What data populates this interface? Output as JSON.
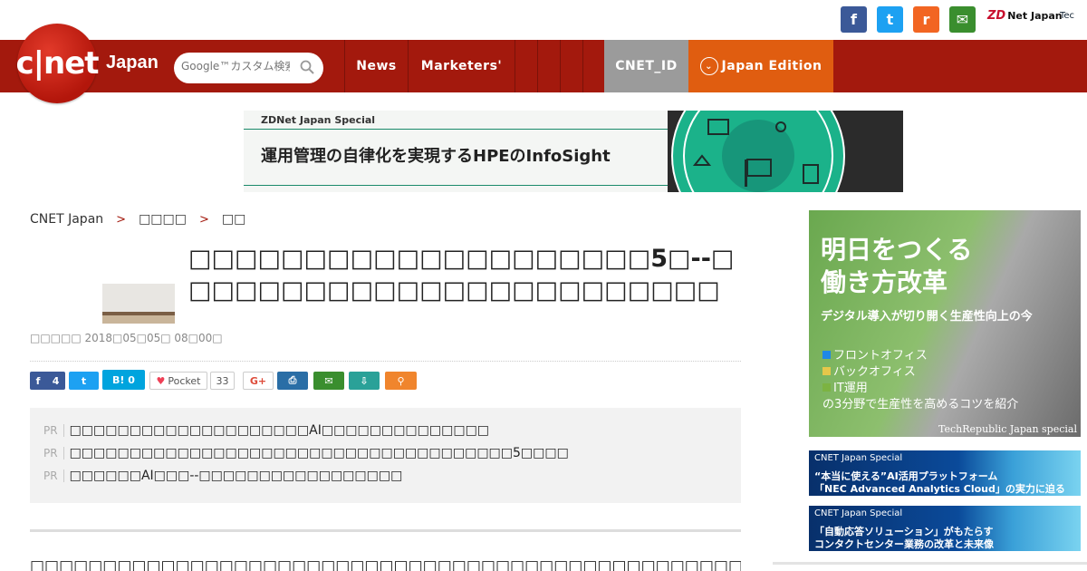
{
  "header": {
    "social": {
      "facebook": "f",
      "twitter": "t",
      "rss": "r",
      "mail": "✉"
    },
    "zdnet": {
      "logo": "ZD",
      "text": "Net Japan"
    },
    "tech_label": "Tec",
    "logo_text": "c|net",
    "logo_region": "Japan",
    "search_placeholder": "Google™カスタム検索",
    "nav": [
      "News",
      "Marketers'",
      "",
      "",
      "",
      ""
    ],
    "cnet_id": "CNET_ID",
    "edition": "Japan Edition"
  },
  "banner": {
    "tag": "ZDNet Japan Special",
    "title": "運用管理の自律化を実現するHPEのInfoSight"
  },
  "breadcrumb": [
    "CNET Japan",
    "□□□□",
    "□□"
  ],
  "article": {
    "title": "□□□□□□□□□□□□□□□□□□□□5□--□□□□□□□□□□□□□□□□□□□□□□□□",
    "byline": "□□□□□ 2018□05□05□ 08□00□"
  },
  "share": {
    "fb_count": "4",
    "hatena": "B! 0",
    "pocket": "Pocket",
    "pocket_count": "33",
    "gplus": "G+"
  },
  "pr": [
    {
      "tag": "PR",
      "text": "□□□□□□□□□□□□□□□□□□□□AI□□□□□□□□□□□□□□"
    },
    {
      "tag": "PR",
      "text": "□□□□□□□□□□□□□□□□□□□□□□□□□□□□□□□□□□□□□5□□□□"
    },
    {
      "tag": "PR",
      "text": "□□□□□□AI□□□--□□□□□□□□□□□□□□□□□"
    }
  ],
  "body_text": "□□□□□□□□□□□□□□□□□□□□□□□□□□□□□□□□□□□□□□□□□□□□□□□□□□□",
  "sidebar": {
    "ad_big": {
      "heading_1": "明日をつくる",
      "heading_2": "働き方改革",
      "sub": "デジタル導入が切り開く生産性向上の今",
      "items": [
        "フロントオフィス",
        "バックオフィス",
        "IT運用"
      ],
      "item_colors": [
        "#1e88e5",
        "#e6c74a",
        "#7cb342"
      ],
      "tagline": "の3分野で生産性を高めるコツを紹介",
      "footer": "TechRepublic Japan special"
    },
    "ad_small_1": {
      "tag": "CNET Japan Special",
      "line1": "“本当に使える”AI活用プラットフォーム",
      "line2": "「NEC Advanced Analytics Cloud」の実力に迫る"
    },
    "ad_small_2": {
      "tag": "CNET Japan Special",
      "line1": "「自動応答ソリューション」がもたらす",
      "line2": "コンタクトセンター業務の改革と未来像"
    }
  }
}
